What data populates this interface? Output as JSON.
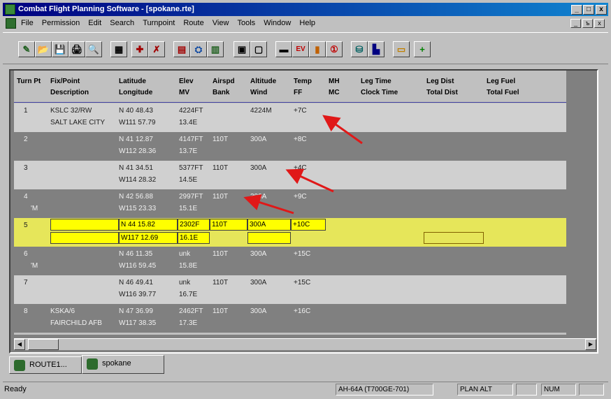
{
  "window": {
    "title": "Combat Flight Planning Software - [spokane.rte]",
    "controls": {
      "minimize": "_",
      "maximize": "□",
      "close": "x"
    }
  },
  "menu": {
    "items": [
      "File",
      "Permission",
      "Edit",
      "Search",
      "Turnpoint",
      "Route",
      "View",
      "Tools",
      "Window",
      "Help"
    ],
    "mdi_controls": {
      "minimize": "_",
      "restore": "ъ",
      "close": "x"
    }
  },
  "toolbar": {
    "buttons": [
      "✎",
      "📂",
      "💾",
      "🖨",
      "🔍",
      "▦",
      "✚",
      "✗",
      "▤",
      "⛭",
      "▥",
      "▣",
      "▢",
      "▬",
      "EV",
      "▮",
      "①",
      "⛁",
      "▙",
      "▭",
      "+"
    ]
  },
  "grid": {
    "headers": [
      [
        "Turn Pt",
        ""
      ],
      [
        "Fix/Point",
        "Description"
      ],
      [
        "Latitude",
        "Longitude"
      ],
      [
        "Elev",
        "MV"
      ],
      [
        "Airspd",
        "Bank"
      ],
      [
        "Altitude",
        "Wind"
      ],
      [
        "Temp",
        "FF"
      ],
      [
        "MH",
        "MC"
      ],
      [
        "Leg Time",
        "Clock Time"
      ],
      [
        "Leg Dist",
        "Total Dist"
      ],
      [
        "Leg Fuel",
        "Total Fuel"
      ]
    ],
    "rows": [
      {
        "turn": "1",
        "turn2": "",
        "fix": "KSLC 32/RW",
        "desc": "SALT LAKE CITY",
        "lat": "N 40 48.43",
        "lon": "W111 57.79",
        "elev": "4224FT",
        "mv": "13.4E",
        "airspd": "",
        "bank": "",
        "alt": "4224M",
        "wind": "",
        "temp": "+7C",
        "ff": ""
      },
      {
        "turn": "2",
        "turn2": "",
        "fix": "",
        "desc": "",
        "lat": "N 41 12.87",
        "lon": "W112 28.36",
        "elev": "4147FT",
        "mv": "13.7E",
        "airspd": "110T",
        "bank": "",
        "alt": "300A",
        "wind": "",
        "temp": "+8C",
        "ff": ""
      },
      {
        "turn": "3",
        "turn2": "",
        "fix": "",
        "desc": "",
        "lat": "N 41 34.51",
        "lon": "W114 28.32",
        "elev": "5377FT",
        "mv": "14.5E",
        "airspd": "110T",
        "bank": "",
        "alt": "300A",
        "wind": "",
        "temp": "+4C",
        "ff": ""
      },
      {
        "turn": "4",
        "turn2": "'M",
        "fix": "",
        "desc": "",
        "lat": "N 42 56.88",
        "lon": "W115 23.33",
        "elev": "2997FT",
        "mv": "15.1E",
        "airspd": "110T",
        "bank": "",
        "alt": "300A",
        "wind": "",
        "temp": "+9C",
        "ff": ""
      },
      {
        "turn": "5",
        "turn2": "",
        "fix": "",
        "desc": "",
        "lat": "N 44 15.82",
        "lon": "W117 12.69",
        "elev": "2302F",
        "mv": "16.1E",
        "airspd": "110T",
        "bank": "",
        "alt": "300A",
        "wind": "",
        "temp": "+10C",
        "ff": ""
      },
      {
        "turn": "6",
        "turn2": "'M",
        "fix": "",
        "desc": "",
        "lat": "N 46 11.35",
        "lon": "W116 59.45",
        "elev": "unk",
        "mv": "15.8E",
        "airspd": "110T",
        "bank": "",
        "alt": "300A",
        "wind": "",
        "temp": "+15C",
        "ff": ""
      },
      {
        "turn": "7",
        "turn2": "",
        "fix": "",
        "desc": "",
        "lat": "N 46 49.41",
        "lon": "W116 39.77",
        "elev": "unk",
        "mv": "16.7E",
        "airspd": "110T",
        "bank": "",
        "alt": "300A",
        "wind": "",
        "temp": "+15C",
        "ff": ""
      },
      {
        "turn": "8",
        "turn2": "",
        "fix": "KSKA/6",
        "desc": "FAIRCHILD AFB",
        "lat": "N 47 36.99",
        "lon": "W117 38.35",
        "elev": "2462FT",
        "mv": "17.3E",
        "airspd": "110T",
        "bank": "",
        "alt": "300A",
        "wind": "",
        "temp": "+16C",
        "ff": ""
      }
    ]
  },
  "scrollbar": {
    "left": "◀",
    "right": "▶"
  },
  "tabs": [
    {
      "label": "ROUTE1..."
    },
    {
      "label": "spokane"
    }
  ],
  "status": {
    "message": "Ready",
    "aircraft": "AH-64A (T700GE-701)",
    "mode": "PLAN ALT",
    "blank": "",
    "num": "NUM"
  },
  "colors": {
    "title_start": "#000080",
    "title_end": "#1084d0",
    "selection": "#e6e65a",
    "edit": "#ffff00",
    "arrow": "#e01818"
  }
}
